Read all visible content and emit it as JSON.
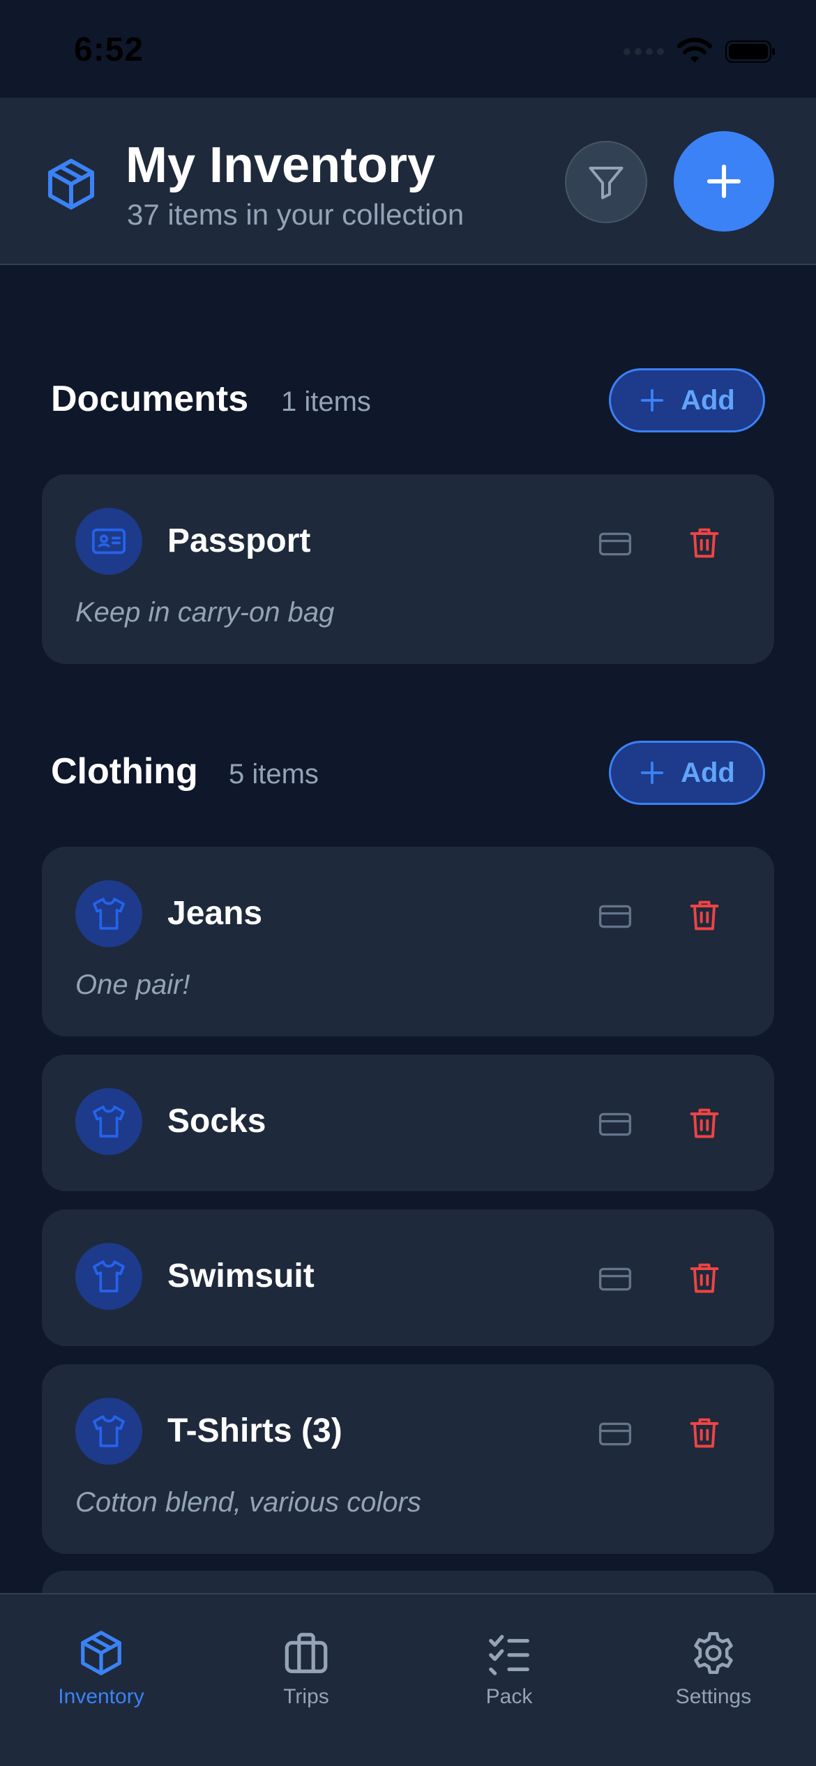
{
  "status_bar": {
    "time": "6:52"
  },
  "header": {
    "title": "My Inventory",
    "subtitle": "37 items in your collection",
    "logo_icon": "cube-icon",
    "filter_icon": "filter-icon",
    "add_icon": "plus-icon"
  },
  "sections": [
    {
      "title": "Documents",
      "count": "1 items",
      "add_label": "Add",
      "items": [
        {
          "name": "Passport",
          "note": "Keep in carry-on bag",
          "icon": "id-card-icon"
        }
      ]
    },
    {
      "title": "Clothing",
      "count": "5 items",
      "add_label": "Add",
      "items": [
        {
          "name": "Jeans",
          "note": "One pair!",
          "icon": "shirt-icon"
        },
        {
          "name": "Socks",
          "note": "",
          "icon": "shirt-icon"
        },
        {
          "name": "Swimsuit",
          "note": "",
          "icon": "shirt-icon"
        },
        {
          "name": "T-Shirts (3)",
          "note": "Cotton blend, various colors",
          "icon": "shirt-icon"
        }
      ]
    }
  ],
  "bottom_nav": {
    "items": [
      {
        "label": "Inventory",
        "icon": "cube-icon",
        "active": true
      },
      {
        "label": "Trips",
        "icon": "briefcase-icon",
        "active": false
      },
      {
        "label": "Pack",
        "icon": "checklist-icon",
        "active": false
      },
      {
        "label": "Settings",
        "icon": "gear-icon",
        "active": false
      }
    ]
  },
  "colors": {
    "background": "#0f172a",
    "surface": "#1e293b",
    "accent": "#3b82f6",
    "accent_light": "#60a5fa",
    "icon_circle": "#1e3a8a",
    "danger": "#ef4444",
    "muted": "#94a3b8"
  }
}
